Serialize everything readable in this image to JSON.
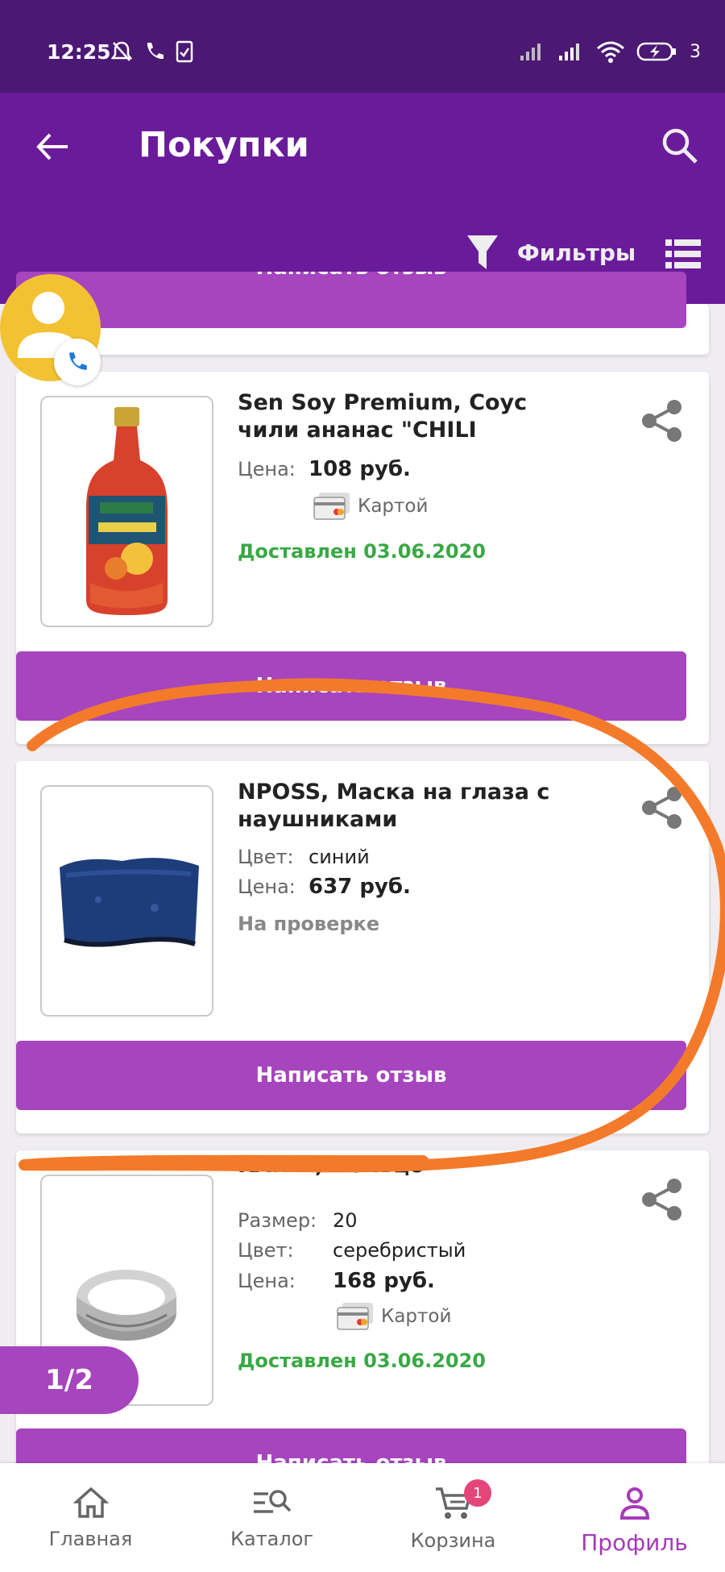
{
  "status_bar": {
    "time": "12:25",
    "battery": "3"
  },
  "header": {
    "title": "Покупки",
    "filters_label": "Фильтры"
  },
  "top_card": {
    "review_label": "Написать отзыв"
  },
  "products": [
    {
      "name": "Sen Soy Premium, Соус чили ананас \"CHILI",
      "price_label": "Цена:",
      "price": "108 руб.",
      "payment": "Картой",
      "status": "Доставлен 03.06.2020",
      "review_label": "Написать отзыв"
    },
    {
      "name": "NPOSS, Маска на глаза с наушниками",
      "color_label": "Цвет:",
      "color": "синий",
      "price_label": "Цена:",
      "price": "637 руб.",
      "status": "На проверке",
      "review_label": "Написать отзыв"
    },
    {
      "name": "KARAT, Кольцо",
      "size_label": "Размер:",
      "size": "20",
      "color_label": "Цвет:",
      "color": "серебристый",
      "price_label": "Цена:",
      "price": "168 руб.",
      "payment": "Картой",
      "status": "Доставлен 03.06.2020",
      "review_label": "Написать отзыв"
    }
  ],
  "pagination": {
    "label": "1/2"
  },
  "bottom_nav": {
    "home": "Главная",
    "catalog": "Каталог",
    "cart": "Корзина",
    "cart_count": "1",
    "profile": "Профиль"
  },
  "colors": {
    "appbar": "#6a1b9a",
    "statusbar": "#4b1873",
    "accent": "#a645be",
    "delivered": "#3aa845",
    "annotation": "#f47a2b"
  }
}
